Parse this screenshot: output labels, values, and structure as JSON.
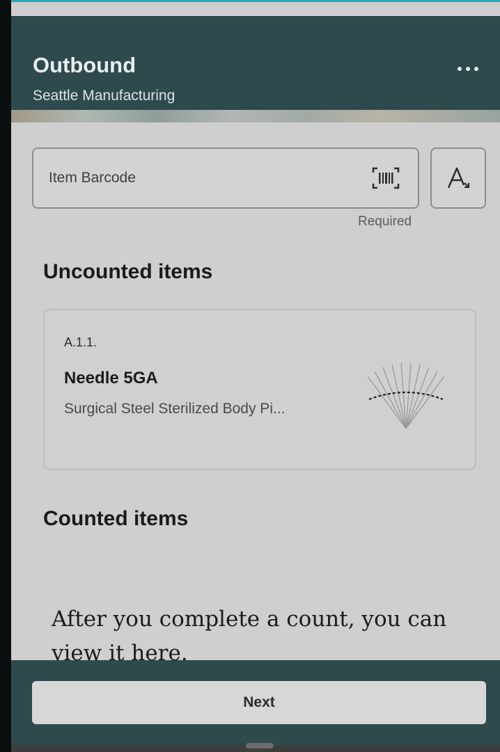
{
  "header": {
    "title": "Outbound",
    "subtitle": "Seattle Manufacturing",
    "more_icon": "more-horizontal-icon"
  },
  "scan": {
    "placeholder": "Item Barcode",
    "helper_text": "Required",
    "barcode_icon": "barcode-scan-icon",
    "font_icon": "text-size-icon"
  },
  "uncounted": {
    "title": "Uncounted items",
    "items": [
      {
        "location": "A.1.1.",
        "name": "Needle 5GA",
        "description": "Surgical Steel Sterilized Body Pi..."
      }
    ]
  },
  "counted": {
    "title": "Counted items",
    "empty_message": "After you complete a count, you can view it here."
  },
  "footer": {
    "next_label": "Next"
  },
  "colors": {
    "header_bg": "#2f4a4d",
    "content_bg": "#cfcfcf",
    "accent": "#2fa7b3"
  }
}
